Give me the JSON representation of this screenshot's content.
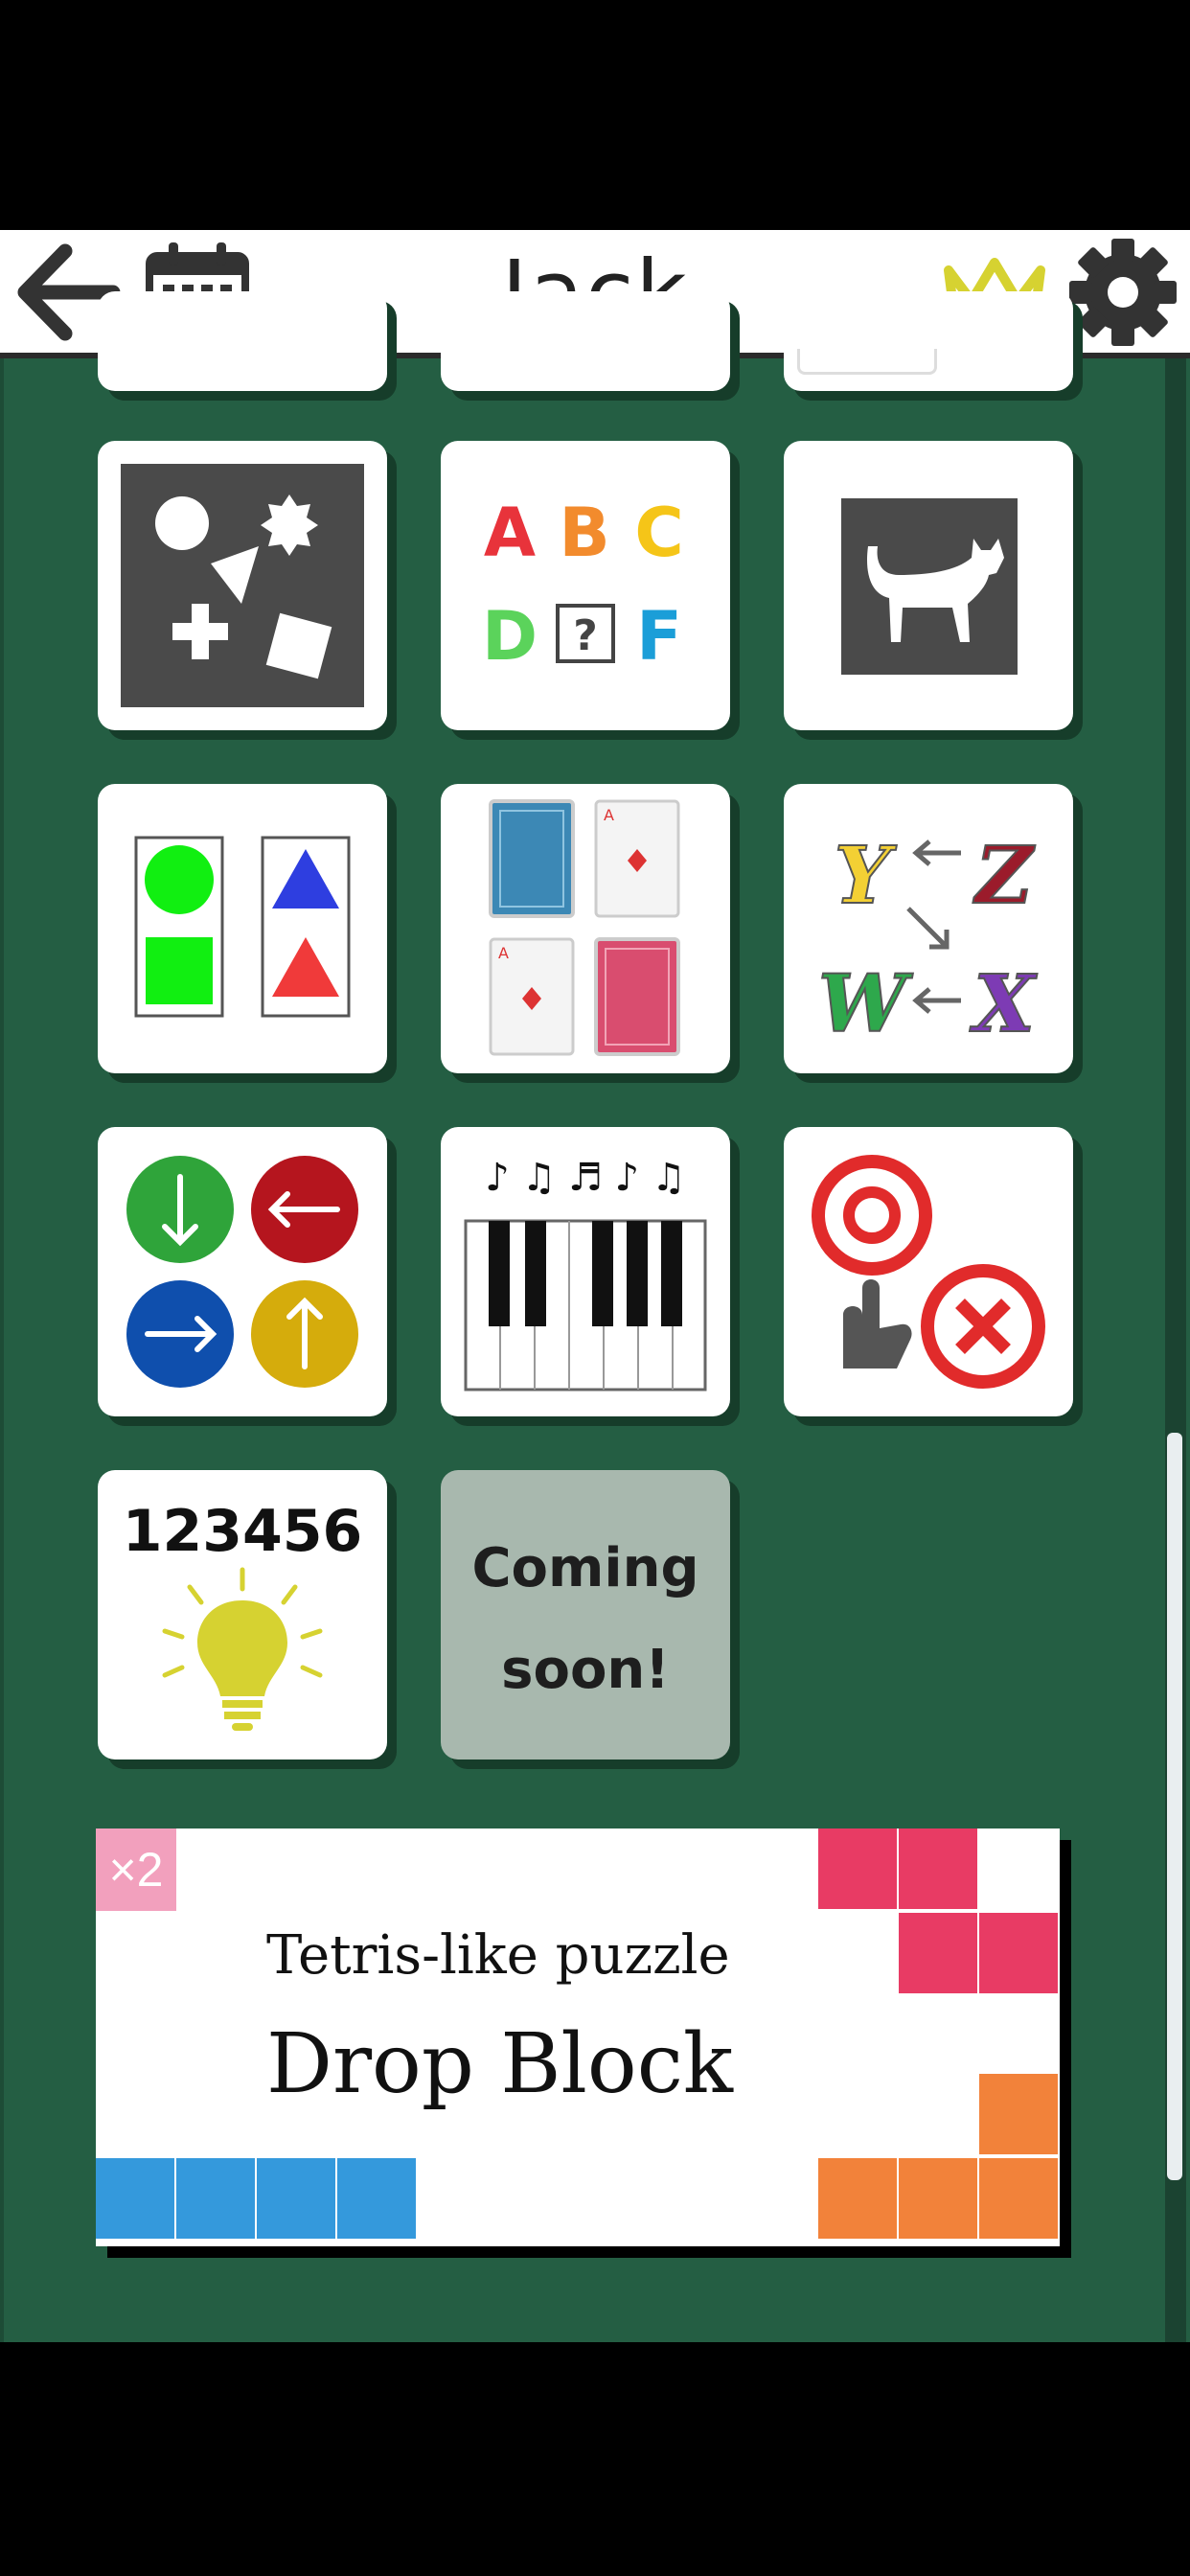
{
  "header": {
    "title": "Jack",
    "icons": [
      "back-arrow-icon",
      "calendar-icon",
      "crown-icon",
      "gear-icon"
    ]
  },
  "tiles": [
    {
      "name": "shapes-game",
      "icon": "shapes-icon"
    },
    {
      "name": "letters-game",
      "icon": "letters-icon",
      "letters": [
        "A",
        "B",
        "C",
        "D",
        "?",
        "F"
      ]
    },
    {
      "name": "silhouette-game",
      "icon": "cat-silhouette-icon"
    },
    {
      "name": "matching-game",
      "icon": "color-shape-cards-icon"
    },
    {
      "name": "memory-cards-game",
      "icon": "playing-cards-icon",
      "card_label": "A"
    },
    {
      "name": "alphabet-order-game",
      "icon": "letter-order-icon",
      "letters": [
        "Y",
        "Z",
        "W",
        "X"
      ]
    },
    {
      "name": "arrows-game",
      "icon": "arrows-icon"
    },
    {
      "name": "piano-game",
      "icon": "piano-icon",
      "notes": "♪ ♫ ♬ ♪ ♫"
    },
    {
      "name": "true-false-game",
      "icon": "circle-cross-icon"
    },
    {
      "name": "number-memory-game",
      "icon": "lightbulb-icon",
      "number": "123456"
    }
  ],
  "coming_soon": {
    "line1": "Coming",
    "line2": "soon!"
  },
  "banner": {
    "badge": "×2",
    "subtitle": "Tetris-like puzzle",
    "title": "Drop Block"
  },
  "colors": {
    "board": "#245e43",
    "crown": "#d6d231",
    "pink_block": "#e83b64",
    "orange_block": "#f2823a",
    "blue_block": "#3499dc"
  }
}
